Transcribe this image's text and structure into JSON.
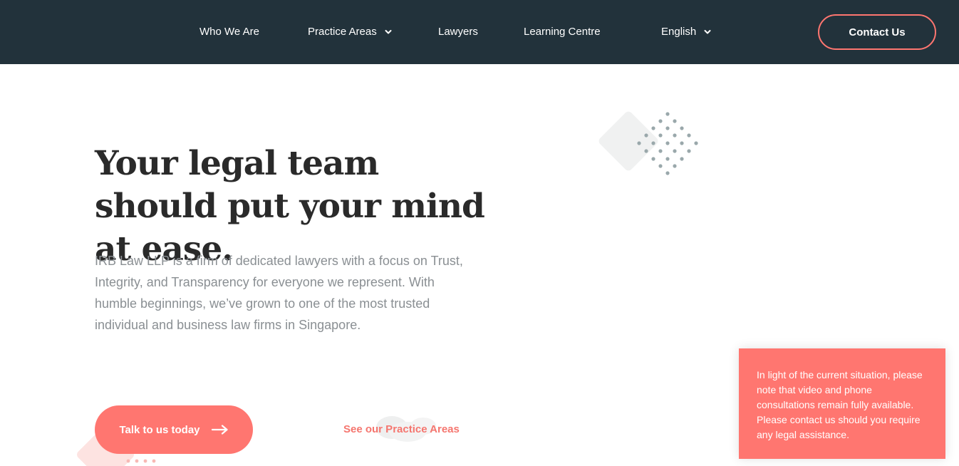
{
  "nav": {
    "items": [
      {
        "label": "Who We Are"
      },
      {
        "label": "Practice Areas",
        "icon": "chevron-down-icon"
      },
      {
        "label": "Lawyers"
      },
      {
        "label": "Learning Centre"
      },
      {
        "label": "English",
        "icon": "chevron-down-icon"
      }
    ],
    "contact_label": "Contact Us"
  },
  "hero": {
    "title": "Your legal team should put your mind at ease.",
    "description": "IRB Law LLP is a firm of dedicated lawyers with a focus on Trust, Integrity, and Transparency for everyone we represent. With humble beginnings, we’ve grown to one of the most trusted individual and business law firms in Singapore.",
    "cta_label": "Talk to us today",
    "cta_icon": "arrow-right-icon",
    "secondary_link": "See our Practice Areas"
  },
  "notice": {
    "text": "In light of the current situation, please note that video and phone consultations remain fully available. Please contact us should you require any legal assistance."
  },
  "colors": {
    "nav_bg": "#22323b",
    "accent": "#ff7670",
    "heading": "#2a2a2a",
    "body_text": "#8a8f93",
    "dots": "#9aa8ab"
  }
}
